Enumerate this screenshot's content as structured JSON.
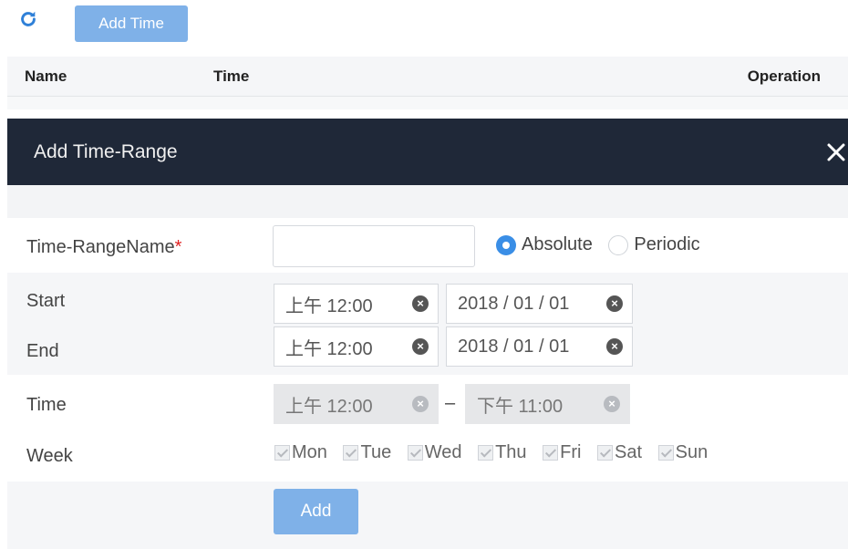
{
  "toolbar": {
    "refresh_icon": "refresh-icon",
    "add_time_label": "Add Time"
  },
  "table": {
    "columns": [
      "Name",
      "Time",
      "Operation"
    ]
  },
  "modal": {
    "title": "Add Time-Range",
    "close_icon": "close-icon",
    "name_label": "Time-RangeName",
    "required_mark": "*",
    "name_value": "",
    "mode_options": [
      "Absolute",
      "Periodic"
    ],
    "mode_selected": "Absolute",
    "start_label": "Start",
    "start_time": "上午 12:00",
    "start_date": "2018 / 01 / 01",
    "end_label": "End",
    "end_time": "上午 12:00",
    "end_date": "2018 / 01 / 01",
    "time_label": "Time",
    "time_from": "上午 12:00",
    "time_sep": "–",
    "time_to": "下午 11:00",
    "week_label": "Week",
    "week_days": [
      "Mon",
      "Tue",
      "Wed",
      "Thu",
      "Fri",
      "Sat",
      "Sun"
    ],
    "add_label": "Add",
    "clear_glyph": "×"
  },
  "colors": {
    "accent": "#7fb1e8",
    "header_bg": "#1f2838",
    "radio_on": "#3a8ee6",
    "required": "#e02020"
  }
}
